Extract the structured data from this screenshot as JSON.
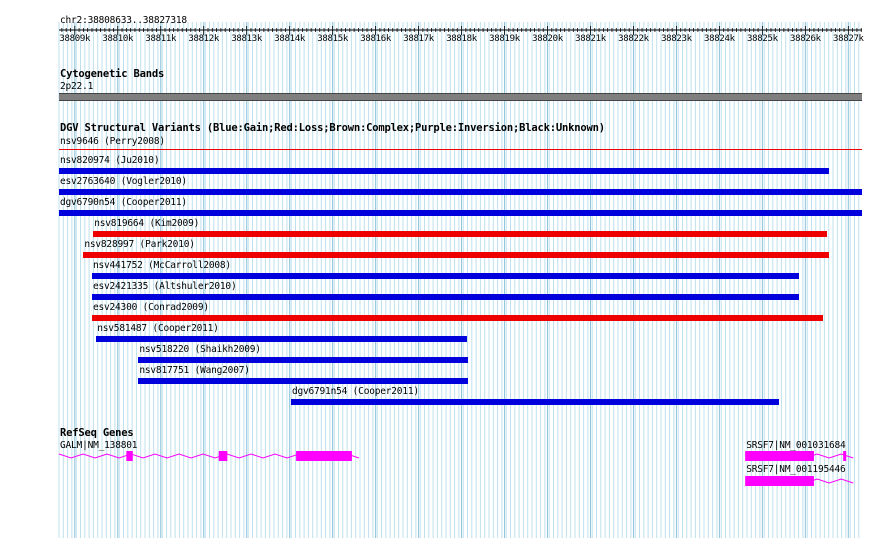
{
  "locus": "chr2:38808633..38827318",
  "ruler_ticks": [
    "38809k",
    "38810k",
    "38811k",
    "38812k",
    "38813k",
    "38814k",
    "38815k",
    "38816k",
    "38817k",
    "38818k",
    "38819k",
    "38820k",
    "38821k",
    "38822k",
    "38823k",
    "38824k",
    "38825k",
    "38826k",
    "38827k"
  ],
  "cytoband": {
    "title": "Cytogenetic Bands",
    "label": "2p22.1",
    "color": "#7f7f7f"
  },
  "dgv": {
    "title": "DGV Structural Variants (Blue:Gain;Red:Loss;Brown:Complex;Purple:Inversion;Black:Unknown)",
    "colors": {
      "gain": "#0000dd",
      "loss": "#ee0000"
    },
    "variants": [
      {
        "label": "nsv9646 (Perry2008)",
        "start": 38808633,
        "end": 38827318,
        "type": "loss",
        "thin": true
      },
      {
        "label": "nsv820974 (Ju2010)",
        "start": 38808633,
        "end": 38826540,
        "type": "gain"
      },
      {
        "label": "esv2763640 (Vogler2010)",
        "start": 38808633,
        "end": 38827318,
        "type": "gain"
      },
      {
        "label": "dgv6790n54 (Cooper2011)",
        "start": 38808633,
        "end": 38827318,
        "type": "gain"
      },
      {
        "label": "nsv819664 (Kim2009)",
        "start": 38809430,
        "end": 38826500,
        "type": "loss"
      },
      {
        "label": "nsv828997 (Park2010)",
        "start": 38809200,
        "end": 38826540,
        "type": "loss"
      },
      {
        "label": "nsv441752 (McCarroll2008)",
        "start": 38809400,
        "end": 38825850,
        "type": "gain"
      },
      {
        "label": "esv2421335 (Altshuler2010)",
        "start": 38809400,
        "end": 38825850,
        "type": "gain"
      },
      {
        "label": "esv24300 (Conrad2009)",
        "start": 38809400,
        "end": 38826400,
        "type": "loss"
      },
      {
        "label": "nsv581487 (Cooper2011)",
        "start": 38809500,
        "end": 38818130,
        "type": "gain"
      },
      {
        "label": "nsv518220 (Shaikh2009)",
        "start": 38810480,
        "end": 38818150,
        "type": "gain"
      },
      {
        "label": "nsv817751 (Wang2007)",
        "start": 38810480,
        "end": 38818150,
        "type": "gain"
      },
      {
        "label": "dgv6791n54 (Cooper2011)",
        "start": 38814030,
        "end": 38825380,
        "type": "gain"
      }
    ]
  },
  "refseq": {
    "title": "RefSeq Genes",
    "color": "#ff00ff",
    "genes": [
      {
        "label": "GALM|NM_138801",
        "start": 38808633,
        "end": 38815850,
        "exons": [
          [
            38810200,
            38810350
          ],
          [
            38812350,
            38812550
          ],
          [
            38814150,
            38815450
          ]
        ]
      },
      {
        "label": "SRSF7|NM_001031684",
        "start": 38824600,
        "end": 38827318,
        "exons": [
          [
            38824600,
            38826200
          ],
          [
            38826880,
            38826950
          ]
        ]
      },
      {
        "label": "SRSF7|NM_001195446",
        "start": 38824600,
        "end": 38827318,
        "exons": [
          [
            38824600,
            38826200
          ]
        ]
      }
    ]
  }
}
